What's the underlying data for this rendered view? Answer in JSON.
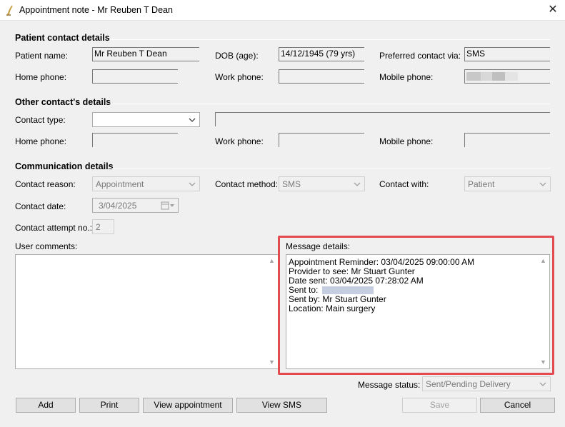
{
  "window": {
    "title": "Appointment note - Mr Reuben T Dean",
    "close_symbol": "✕"
  },
  "patient_contact": {
    "heading": "Patient contact details",
    "patient_name_label": "Patient name:",
    "patient_name_value": "Mr Reuben T Dean",
    "dob_label": "DOB (age):",
    "dob_value": "14/12/1945 (79 yrs)",
    "preferred_contact_label": "Preferred contact via:",
    "preferred_contact_value": "SMS",
    "home_phone_label": "Home phone:",
    "home_phone_value": "",
    "work_phone_label": "Work phone:",
    "work_phone_value": "",
    "mobile_phone_label": "Mobile phone:",
    "mobile_phone_value": ""
  },
  "other_contact": {
    "heading": "Other contact's details",
    "contact_type_label": "Contact type:",
    "contact_type_value": "",
    "contact_name_value": "",
    "home_phone_label": "Home phone:",
    "home_phone_value": "",
    "work_phone_label": "Work phone:",
    "work_phone_value": "",
    "mobile_phone_label": "Mobile phone:",
    "mobile_phone_value": ""
  },
  "communication": {
    "heading": "Communication details",
    "contact_reason_label": "Contact reason:",
    "contact_reason_value": "Appointment",
    "contact_method_label": "Contact method:",
    "contact_method_value": "SMS",
    "contact_with_label": "Contact with:",
    "contact_with_value": "Patient",
    "contact_date_label": "Contact date:",
    "contact_date_value": "3/04/2025",
    "attempt_label": "Contact attempt no.:",
    "attempt_value": "2",
    "user_comments_label": "User comments:",
    "user_comments_value": "",
    "message_details_label": "Message details:",
    "message_lines": [
      "Appointment Reminder: 03/04/2025 09:00:00 AM",
      "Provider to see: Mr Stuart Gunter",
      "Date sent: 03/04/2025 07:28:02 AM",
      "Sent to:",
      "Sent by: Mr Stuart Gunter",
      "Location: Main surgery"
    ],
    "message_status_label": "Message status:",
    "message_status_value": "Sent/Pending Delivery"
  },
  "buttons": {
    "add": "Add",
    "print": "Print",
    "view_appointment": "View appointment",
    "view_sms": "View SMS",
    "save": "Save",
    "cancel": "Cancel"
  },
  "colors": {
    "highlight": "#e24b4f",
    "window_bg": "#f0f0f0"
  },
  "icons": {
    "app": "app-logo-icon",
    "close": "close-icon",
    "dropdown": "chevron-down-icon",
    "calendar": "calendar-icon",
    "scroll_up": "scroll-up-arrow-icon",
    "scroll_down": "scroll-down-arrow-icon"
  }
}
